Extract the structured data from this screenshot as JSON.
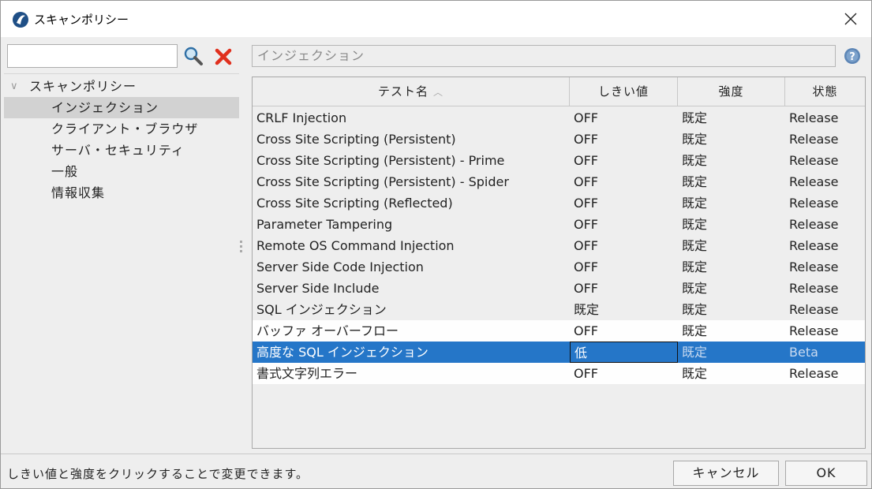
{
  "window": {
    "title": "スキャンポリシー"
  },
  "left": {
    "search": {
      "value": "",
      "placeholder": ""
    },
    "tree": {
      "root": "スキャンポリシー",
      "items": [
        {
          "label": "インジェクション",
          "selected": true
        },
        {
          "label": "クライアント・ブラウザ"
        },
        {
          "label": "サーバ・セキュリティ"
        },
        {
          "label": "一般"
        },
        {
          "label": "情報収集"
        }
      ]
    }
  },
  "right": {
    "detail": "インジェクション",
    "columns": [
      "テスト名",
      "しきい値",
      "強度",
      "状態"
    ],
    "rows": [
      [
        "CRLF Injection",
        "OFF",
        "既定",
        "Release"
      ],
      [
        "Cross Site Scripting (Persistent)",
        "OFF",
        "既定",
        "Release"
      ],
      [
        "Cross Site Scripting (Persistent) - Prime",
        "OFF",
        "既定",
        "Release"
      ],
      [
        "Cross Site Scripting (Persistent) - Spider",
        "OFF",
        "既定",
        "Release"
      ],
      [
        "Cross Site Scripting (Reflected)",
        "OFF",
        "既定",
        "Release"
      ],
      [
        "Parameter Tampering",
        "OFF",
        "既定",
        "Release"
      ],
      [
        "Remote OS Command Injection",
        "OFF",
        "既定",
        "Release"
      ],
      [
        "Server Side Code Injection",
        "OFF",
        "既定",
        "Release"
      ],
      [
        "Server Side Include",
        "OFF",
        "既定",
        "Release"
      ],
      [
        "SQL インジェクション",
        "既定",
        "既定",
        "Release"
      ],
      [
        "バッファ オーバーフロー",
        "OFF",
        "既定",
        "Release"
      ],
      [
        "高度な SQL インジェクション",
        "低",
        "既定",
        "Beta"
      ],
      [
        "書式文字列エラー",
        "OFF",
        "既定",
        "Release"
      ]
    ],
    "selected_row": 11
  },
  "status": {
    "text": "しきい値と強度をクリックすることで変更できます。",
    "cancel": "キャンセル",
    "ok": "OK"
  },
  "colors": {
    "selection": "#2576c8",
    "clear_icon": "#e0301e"
  }
}
